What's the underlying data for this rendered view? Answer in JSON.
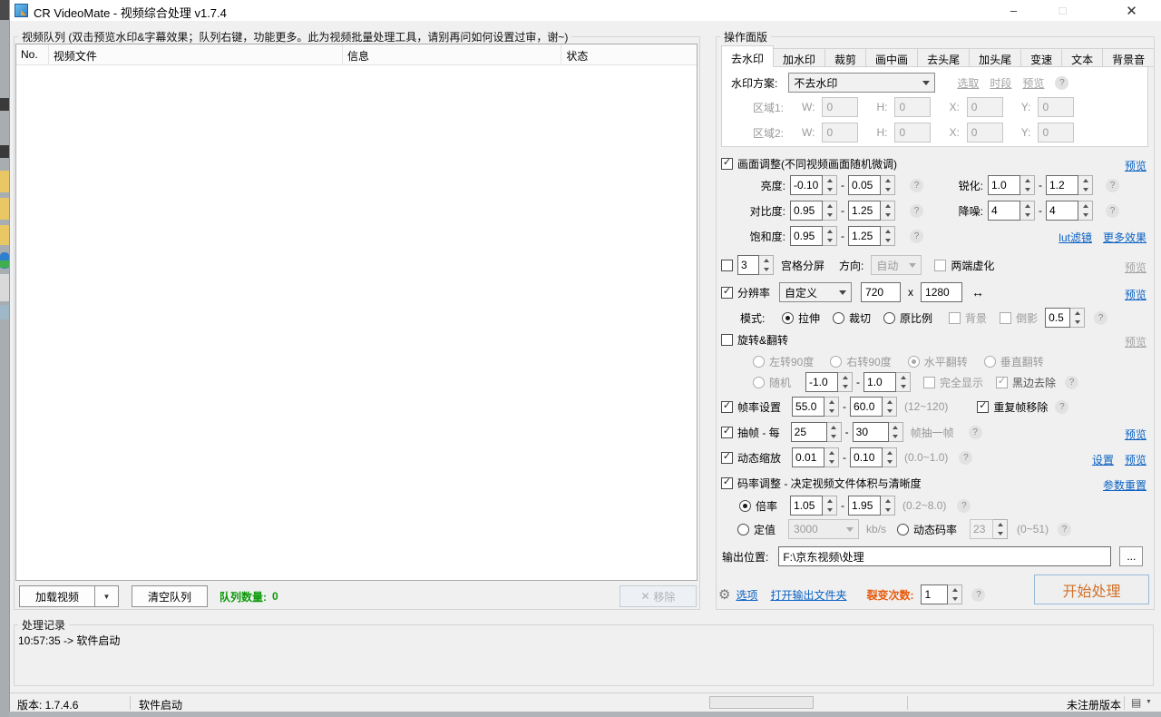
{
  "window": {
    "title": "CR VideoMate - 视频综合处理 v1.7.4"
  },
  "icons": {
    "minimize": "–",
    "maximize": "□",
    "close": "✕",
    "check": "✓",
    "dropdown": "▼",
    "gear": "⚙",
    "remove": "✕",
    "status_menu": "▤"
  },
  "ui": {
    "dash": "-",
    "help": "?"
  },
  "queue": {
    "group_title": "视频队列 (双击预览水印&字幕效果；队列右键，功能更多。此为视频批量处理工具，请别再问如何设置过审，谢~)",
    "columns": [
      "No.",
      "视频文件",
      "信息",
      "状态"
    ],
    "load_button": "加载视频",
    "clear_button": "清空队列",
    "count_label": "队列数量:",
    "count_value": "0",
    "remove_button": "移除"
  },
  "log": {
    "group_title": "处理记录",
    "entry": "10:57:35 -> 软件启动"
  },
  "statusbar": {
    "version": "版本: 1.7.4.6",
    "status": "软件启动",
    "registration": "未注册版本"
  },
  "panel": {
    "group_title": "操作面版",
    "tabs": [
      "去水印",
      "加水印",
      "裁剪",
      "画中画",
      "去头尾",
      "加头尾",
      "变速",
      "文本",
      "背景音"
    ],
    "watermark": {
      "label": "水印方案:",
      "scheme": "不去水印",
      "pick": "选取",
      "period": "时段",
      "preview": "预览",
      "region1_label": "区域1:",
      "region2_label": "区域2:",
      "w_label": "W:",
      "h_label": "H:",
      "x_label": "X:",
      "y_label": "Y:",
      "region1": {
        "w": "0",
        "h": "0",
        "x": "0",
        "y": "0"
      },
      "region2": {
        "w": "0",
        "h": "0",
        "x": "0",
        "y": "0"
      }
    },
    "adjust": {
      "title": "画面调整(不同视频画面随机微调)",
      "preview": "预览",
      "brightness_label": "亮度:",
      "brightness_min": "-0.10",
      "brightness_max": "0.05",
      "sharpen_label": "锐化:",
      "sharpen_min": "1.0",
      "sharpen_max": "1.2",
      "contrast_label": "对比度:",
      "contrast_min": "0.95",
      "contrast_max": "1.25",
      "denoise_label": "降噪:",
      "denoise_min": "4",
      "denoise_max": "4",
      "saturation_label": "饱和度:",
      "saturation_min": "0.95",
      "saturation_max": "1.25",
      "lut_link": "lut滤镜",
      "more_link": "更多效果"
    },
    "grid": {
      "count": "3",
      "label": "宫格分屏",
      "dir_label": "方向:",
      "dir_value": "自动",
      "fade_label": "两端虚化",
      "preview": "预览"
    },
    "res": {
      "label": "分辨率",
      "mode": "自定义",
      "width": "720",
      "sep": "x",
      "height": "1280",
      "swap": "↔",
      "preview": "预览",
      "mode_label": "模式:",
      "opt_stretch": "拉伸",
      "opt_crop": "裁切",
      "opt_ratio": "原比例",
      "bg_label": "背景",
      "reflect_label": "倒影",
      "reflect_value": "0.5"
    },
    "rotate": {
      "title": "旋转&翻转",
      "preview": "预览",
      "left90": "左转90度",
      "right90": "右转90度",
      "hflip": "水平翻转",
      "vflip": "垂直翻转",
      "random_label": "随机",
      "random_min": "-1.0",
      "random_max": "1.0",
      "full_label": "完全显示",
      "deblack_label": "黑边去除"
    },
    "fps": {
      "label": "帧率设置",
      "min": "55.0",
      "max": "60.0",
      "range": "(12~120)",
      "dedup_label": "重复帧移除"
    },
    "extract": {
      "label": "抽帧 - 每",
      "min": "25",
      "max": "30",
      "suffix": "帧抽一帧",
      "preview": "预览"
    },
    "dzoom": {
      "label": "动态缩放",
      "min": "0.01",
      "max": "0.10",
      "range": "(0.0~1.0)",
      "settings_link": "设置",
      "preview": "预览"
    },
    "bitrate": {
      "title": "码率调整 - 决定视频文件体积与清晰度",
      "reset_link": "参数重置",
      "mult_label": "倍率",
      "mult_min": "1.05",
      "mult_max": "1.95",
      "mult_range": "(0.2~8.0)",
      "fixed_label": "定值",
      "fixed_value": "3000",
      "unit": "kb/s",
      "dynamic_label": "动态码率",
      "crf_value": "23",
      "crf_range": "(0~51)"
    },
    "output": {
      "label": "输出位置:",
      "path": "F:\\京东视频\\处理",
      "browse": "...",
      "options_link": "选项",
      "open_folder_link": "打开输出文件夹",
      "split_label": "裂变次数:",
      "split_value": "1",
      "start_button": "开始处理"
    }
  }
}
